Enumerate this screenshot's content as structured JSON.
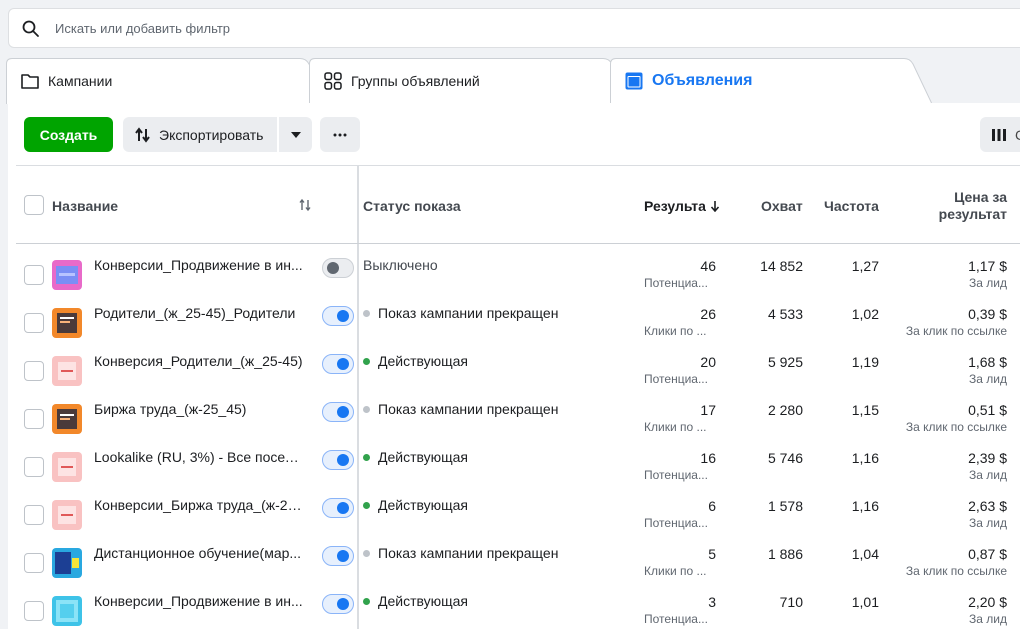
{
  "search": {
    "placeholder": "Искать или добавить фильтр"
  },
  "tabs": [
    {
      "label": "Кампании"
    },
    {
      "label": "Группы объявлений"
    },
    {
      "label": "Объявления"
    }
  ],
  "colors": {
    "accent": "#1877f2",
    "create": "#00a400",
    "active_dot": "#31a24c",
    "inactive_dot": "#bec3c9"
  },
  "toolbar": {
    "create_label": "Создать",
    "export_label": "Экспортировать",
    "columns_label": "C"
  },
  "table": {
    "headers": {
      "name": "Название",
      "status": "Статус показа",
      "results": "Результа",
      "reach": "Охват",
      "frequency": "Частота",
      "cost_line1": "Цена за",
      "cost_line2": "результат"
    },
    "rows": [
      {
        "name": "Конверсии_Продвижение в ин...",
        "toggle": "off",
        "status": "Выключено",
        "status_dot": "none",
        "results": "46",
        "results_sub": "Потенциа...",
        "reach": "14 852",
        "frequency": "1,27",
        "cost": "1,17 $",
        "cost_sub": "За лид"
      },
      {
        "name": "Родители_(ж_25-45)_Родители",
        "toggle": "on",
        "status": "Показ кампании прекращен",
        "status_dot": "grey",
        "results": "26",
        "results_sub": "Клики по ...",
        "reach": "4 533",
        "frequency": "1,02",
        "cost": "0,39 $",
        "cost_sub": "За клик по ссылке"
      },
      {
        "name": "Конверсия_Родители_(ж_25-45)",
        "toggle": "on",
        "status": "Действующая",
        "status_dot": "green",
        "results": "20",
        "results_sub": "Потенциа...",
        "reach": "5 925",
        "frequency": "1,19",
        "cost": "1,68 $",
        "cost_sub": "За лид"
      },
      {
        "name": "Биржа труда_(ж-25_45)",
        "toggle": "on",
        "status": "Показ кампании прекращен",
        "status_dot": "grey",
        "results": "17",
        "results_sub": "Клики по ...",
        "reach": "2 280",
        "frequency": "1,15",
        "cost": "0,51 $",
        "cost_sub": "За клик по ссылке"
      },
      {
        "name": "Lookalike (RU, 3%) - Все посети...",
        "toggle": "on",
        "status": "Действующая",
        "status_dot": "green",
        "results": "16",
        "results_sub": "Потенциа...",
        "reach": "5 746",
        "frequency": "1,16",
        "cost": "2,39 $",
        "cost_sub": "За лид"
      },
      {
        "name": "Конверсии_Биржа труда_(ж-25...",
        "toggle": "on",
        "status": "Действующая",
        "status_dot": "green",
        "results": "6",
        "results_sub": "Потенциа...",
        "reach": "1 578",
        "frequency": "1,16",
        "cost": "2,63 $",
        "cost_sub": "За лид"
      },
      {
        "name": "Дистанционное обучение(мар...",
        "toggle": "on",
        "status": "Показ кампании прекращен",
        "status_dot": "grey",
        "results": "5",
        "results_sub": "Клики по ...",
        "reach": "1 886",
        "frequency": "1,04",
        "cost": "0,87 $",
        "cost_sub": "За клик по ссылке"
      },
      {
        "name": "Конверсии_Продвижение в ин...",
        "toggle": "on",
        "status": "Действующая",
        "status_dot": "green",
        "results": "3",
        "results_sub": "Потенциа...",
        "reach": "710",
        "frequency": "1,01",
        "cost": "2,20 $",
        "cost_sub": "За лид"
      }
    ]
  }
}
